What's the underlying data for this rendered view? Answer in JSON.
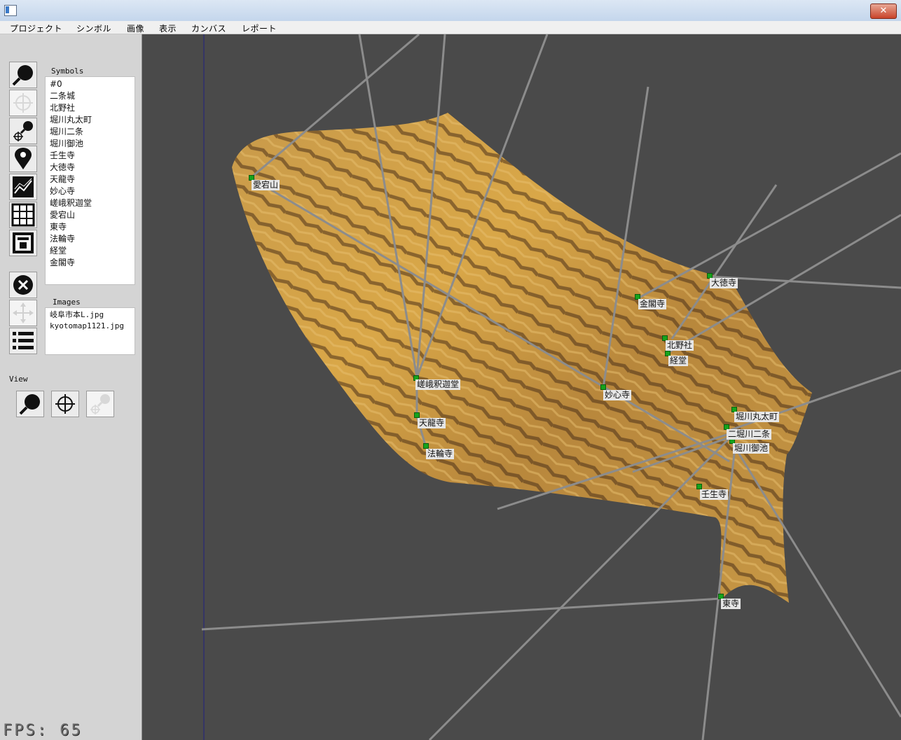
{
  "window": {
    "title": "",
    "close_glyph": "✕"
  },
  "menu": [
    "プロジェクト",
    "シンボル",
    "画像",
    "表示",
    "カンバス",
    "レポート"
  ],
  "sidebar": {
    "tools": [
      {
        "icon": "magnifier-icon",
        "active": false
      },
      {
        "icon": "crosshair-icon",
        "active": true
      },
      {
        "icon": "crosshair-magnifier-icon",
        "active": false
      },
      {
        "icon": "map-pin-icon",
        "active": false
      },
      {
        "icon": "line-chart-icon",
        "active": false
      },
      {
        "icon": "grid-icon",
        "active": false
      },
      {
        "icon": "layout-icon",
        "active": false
      },
      {
        "icon": "delete-circle-icon",
        "active": false
      },
      {
        "icon": "move-arrows-icon",
        "active": true
      },
      {
        "icon": "list-icon",
        "active": false
      }
    ],
    "symbols_label": "Symbols",
    "symbols": [
      "#0",
      "二条城",
      "北野社",
      "堀川丸太町",
      "堀川二条",
      "堀川御池",
      "壬生寺",
      "大徳寺",
      "天龍寺",
      "妙心寺",
      "嵯峨釈迦堂",
      "愛宕山",
      "東寺",
      "法輪寺",
      "経堂",
      "金閣寺"
    ],
    "images_label": "Images",
    "images": [
      "岐阜市本L.jpg",
      "kyotomap1121.jpg"
    ],
    "view_label": "View",
    "view_buttons": [
      {
        "icon": "magnifier-icon",
        "active": false
      },
      {
        "icon": "crosshair-icon",
        "active": false
      },
      {
        "icon": "crosshair-magnifier-icon",
        "active": true
      }
    ]
  },
  "canvas": {
    "labels": [
      "愛宕山",
      "大徳寺",
      "金閣寺",
      "北野社",
      "経堂",
      "嵯峨釈迦堂",
      "妙心寺",
      "天龍寺",
      "法輪寺",
      "堀川丸太町",
      "二堀川二条",
      "堀川御池",
      "壬生寺",
      "東寺"
    ],
    "colors": {
      "background": "#4a4a4a",
      "marker": "#16a31c",
      "line": "#8c8c8c"
    }
  },
  "status": {
    "fps": "FPS: 65"
  }
}
